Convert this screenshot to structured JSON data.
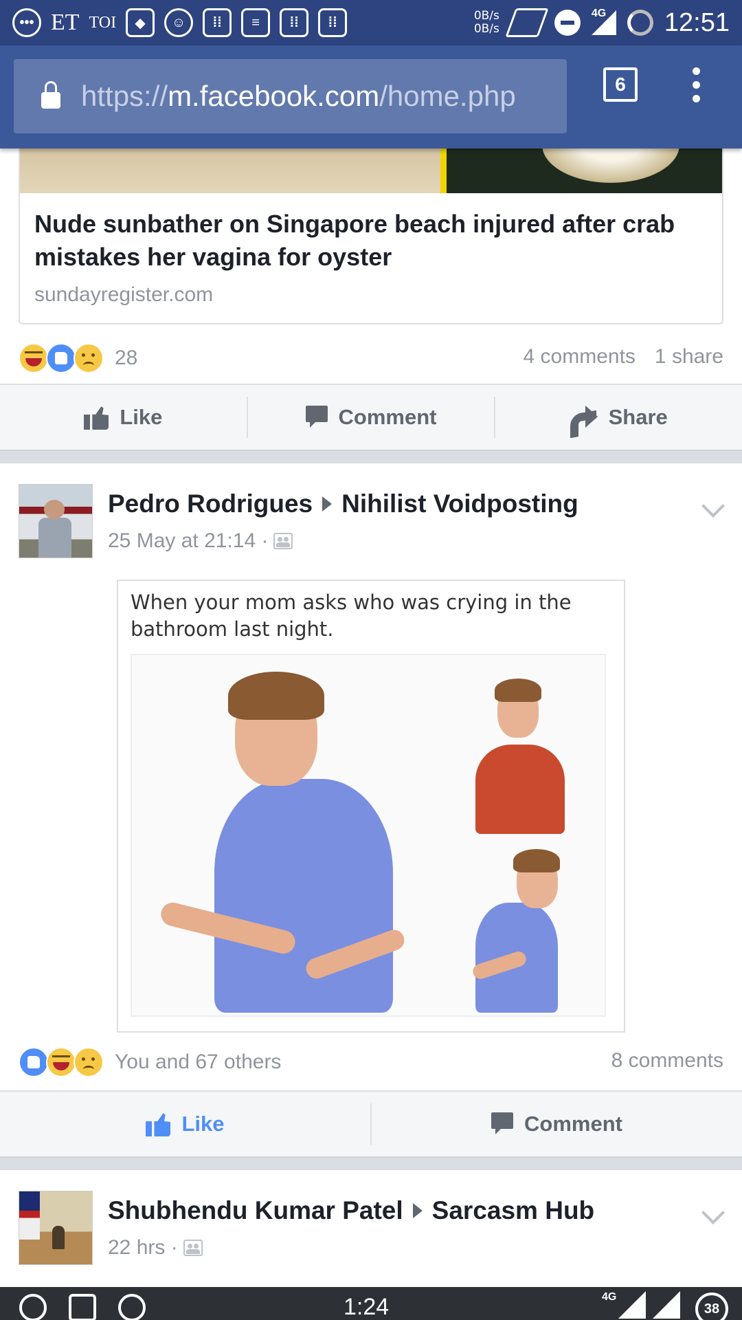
{
  "status_bar": {
    "left_labels": [
      "ET",
      "TOI"
    ],
    "net_speed_up": "0B/s",
    "net_speed_down": "0B/s",
    "network": "4G",
    "time": "12:51"
  },
  "browser": {
    "url_scheme": "https://",
    "url_host": "m.facebook.com",
    "url_path": "/home.php",
    "tab_count": "6"
  },
  "feed": {
    "link_post": {
      "title": "Nude sunbather on Singapore beach injured after crab mistakes her vagina for oyster",
      "domain": "sundayregister.com",
      "reaction_count": "28",
      "comments": "4 comments",
      "shares": "1 share",
      "actions": {
        "like": "Like",
        "comment": "Comment",
        "share": "Share"
      }
    },
    "post_1": {
      "author": "Pedro Rodrigues",
      "group": "Nihilist Voidposting",
      "timestamp": "25 May at 21:14 ·",
      "meme_caption": "When your mom asks who was crying in the bathroom last night.",
      "reaction_text": "You and 67 others",
      "comments": "8 comments",
      "actions": {
        "like": "Like",
        "comment": "Comment"
      }
    },
    "post_2": {
      "author": "Shubhendu Kumar Patel",
      "group": "Sarcasm Hub",
      "timestamp": "22 hrs ·"
    }
  },
  "nav_bar": {
    "time": "1:24",
    "network": "4G",
    "battery": "38"
  },
  "colors": {
    "header": "#3b5998",
    "status_bar": "#2e4480",
    "like_active": "#4f8ef7"
  }
}
